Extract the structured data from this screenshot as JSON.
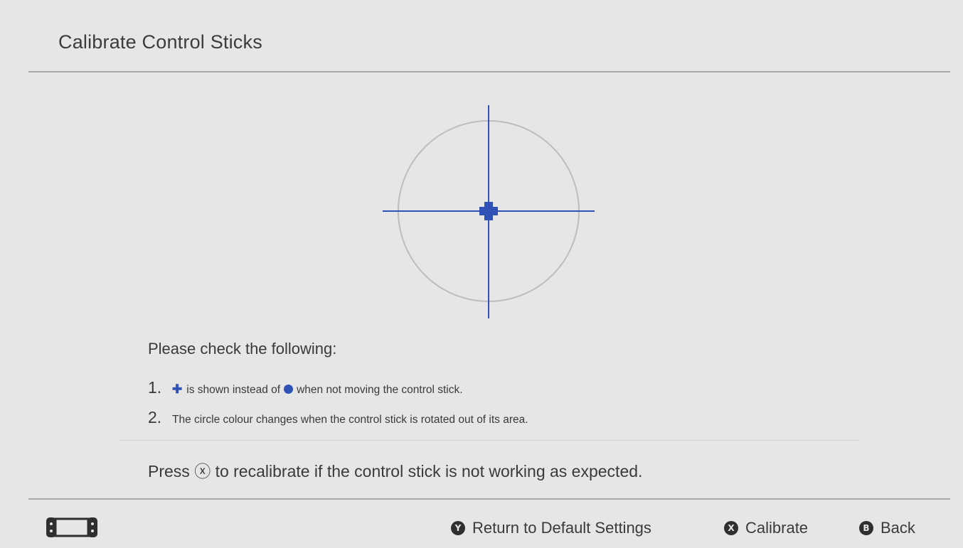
{
  "header": {
    "title": "Calibrate Control Sticks"
  },
  "stick_display": {
    "accent_color": "#2f52b7",
    "circle_color": "#bdbdbd",
    "indicator": "plus-icon"
  },
  "checks": {
    "heading": "Please check the following:",
    "items": [
      {
        "num": "1.",
        "before": "is shown instead of",
        "after": "when not moving the control stick."
      },
      {
        "num": "2.",
        "text": "The circle colour changes when the control stick is rotated out of its area."
      }
    ]
  },
  "instruction": {
    "prefix": "Press",
    "button_glyph": "ⓧ",
    "suffix": "to recalibrate if the control stick is not working as expected."
  },
  "footer": {
    "device_icon": "handheld-console-icon",
    "actions": [
      {
        "button": "Y",
        "label": "Return to Default Settings"
      },
      {
        "button": "X",
        "label": "Calibrate"
      },
      {
        "button": "B",
        "label": "Back"
      }
    ]
  }
}
